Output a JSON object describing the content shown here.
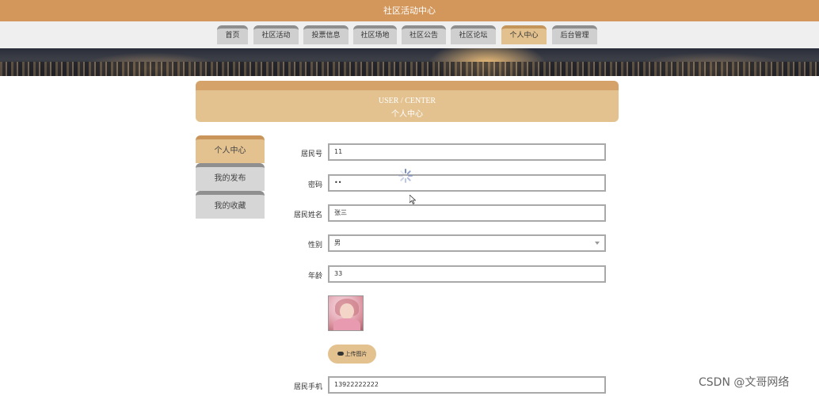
{
  "app": {
    "title": "社区活动中心"
  },
  "nav": {
    "items": [
      {
        "label": "首页"
      },
      {
        "label": "社区活动"
      },
      {
        "label": "投票信息"
      },
      {
        "label": "社区场地"
      },
      {
        "label": "社区公告"
      },
      {
        "label": "社区论坛"
      },
      {
        "label": "个人中心",
        "active": true
      },
      {
        "label": "后台管理"
      }
    ]
  },
  "header": {
    "en": "USER / CENTER",
    "cn": "个人中心"
  },
  "sidebar": {
    "items": [
      {
        "label": "个人中心",
        "active": true
      },
      {
        "label": "我的发布"
      },
      {
        "label": "我的收藏"
      }
    ]
  },
  "form": {
    "resident_no": {
      "label": "居民号",
      "value": "11"
    },
    "password": {
      "label": "密码",
      "value": "••"
    },
    "name": {
      "label": "居民姓名",
      "value": "张三"
    },
    "gender": {
      "label": "性别",
      "value": "男"
    },
    "age": {
      "label": "年龄",
      "value": "33"
    },
    "upload": {
      "label": "上传图片"
    },
    "phone": {
      "label": "居民手机",
      "value": "13922222222"
    }
  },
  "watermark": "CSDN @文哥网络",
  "colors": {
    "accent": "#d4975b",
    "accent_light": "#e3c290",
    "tab_inactive": "#cfcfcf"
  }
}
